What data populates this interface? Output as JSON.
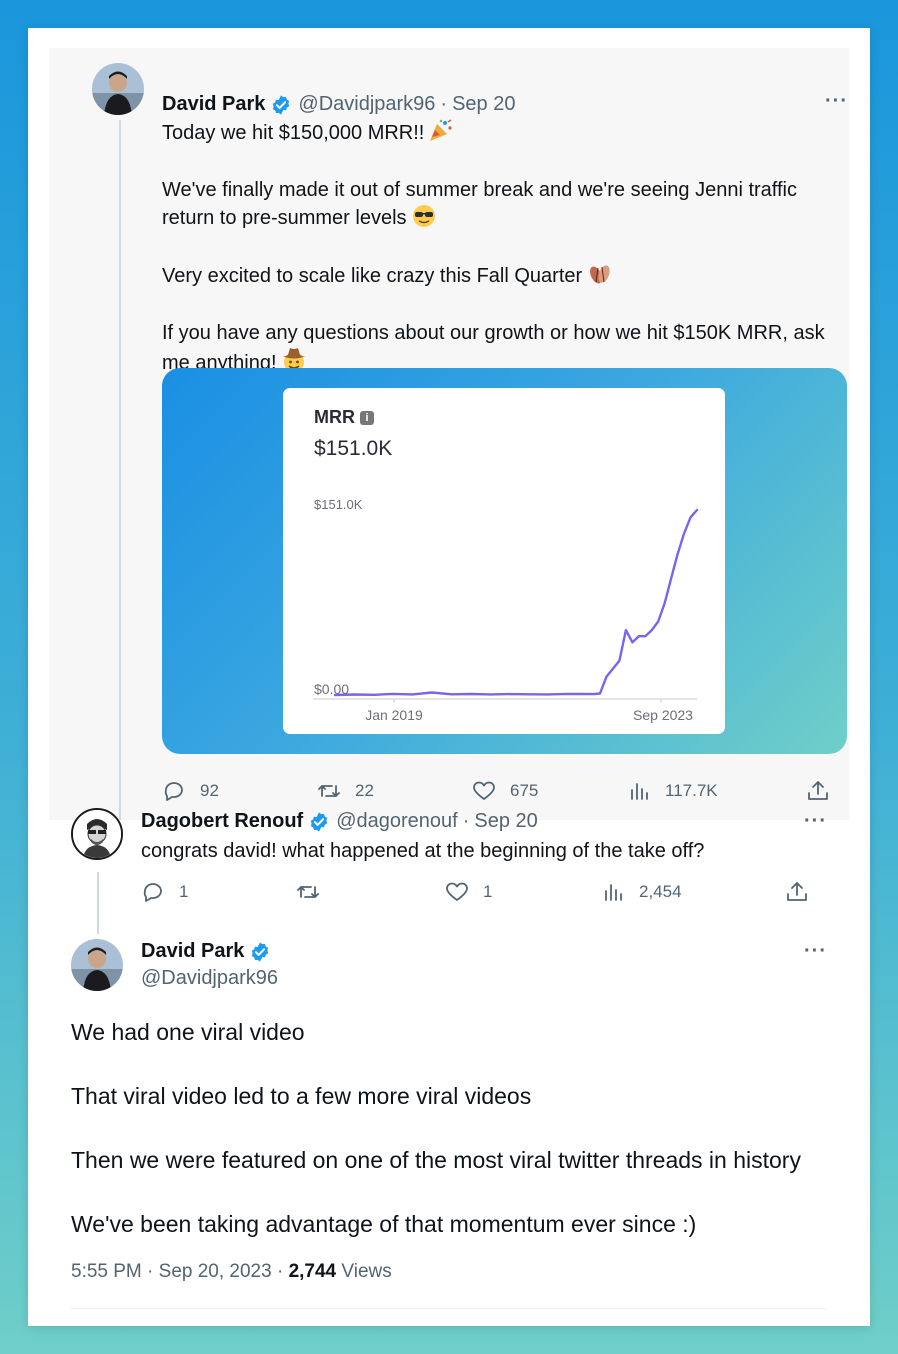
{
  "tweet1": {
    "name": "David Park",
    "handle": "@Davidjpark96",
    "date": "Sep 20",
    "lines": [
      "Today we hit $150,000 MRR!!",
      "We've finally made it out of summer break and we're seeing Jenni traffic return to pre-summer levels",
      "Very excited to scale like crazy this Fall Quarter",
      "If you have any questions about our growth or how we hit $150K MRR, ask me anything!"
    ],
    "emojis": [
      "party-popper-emoji",
      "sunglasses-face-emoji",
      "fallen-leaves-emoji",
      "cowboy-face-emoji"
    ],
    "stats": {
      "replies": "92",
      "retweets": "22",
      "likes": "675",
      "views": "117.7K"
    }
  },
  "chart_data": {
    "type": "line",
    "title": "MRR",
    "headline_value": "$151.0K",
    "y_tick_top": "$151.0K",
    "y_tick_bottom": "$0.00",
    "x_tick_start": "Jan 2019",
    "x_tick_end": "Sep 2023",
    "ylim": [
      0,
      151000
    ],
    "x": [
      "2019-01",
      "2019-04",
      "2019-07",
      "2019-10",
      "2020-01",
      "2020-04",
      "2020-07",
      "2020-10",
      "2021-01",
      "2021-04",
      "2021-07",
      "2021-10",
      "2022-01",
      "2022-03",
      "2022-05",
      "2022-06",
      "2022-07",
      "2022-09",
      "2022-10",
      "2022-11",
      "2022-12",
      "2023-01",
      "2023-02",
      "2023-03",
      "2023-04",
      "2023-05",
      "2023-06",
      "2023-07",
      "2023-08",
      "2023-09"
    ],
    "series": [
      {
        "values": [
          0,
          400,
          200,
          900,
          500,
          2000,
          600,
          800,
          500,
          700,
          600,
          500,
          900,
          800,
          700,
          1200,
          15000,
          28000,
          53000,
          43000,
          48000,
          48000,
          53000,
          60000,
          75000,
          95000,
          115000,
          132000,
          145000,
          151000
        ],
        "color": "#7b63f0"
      }
    ],
    "grid": false,
    "axis_line_color": "#c9ccd1"
  },
  "reply": {
    "name": "Dagobert Renouf",
    "handle": "@dagorenouf",
    "date": "Sep 20",
    "text": "congrats david! what happened at the beginning of the take off?",
    "stats": {
      "replies": "1",
      "likes": "1",
      "views": "2,454"
    }
  },
  "tweet3": {
    "name": "David Park",
    "handle": "@Davidjpark96",
    "paragraphs": [
      "We had one viral video",
      "That viral video led to a few more viral videos",
      "Then we were featured on one of the most viral twitter threads in history",
      "We've been taking advantage of that momentum ever since :)"
    ],
    "timestamp": "5:55 PM · Sep 20, 2023 · ",
    "views_count": "2,744",
    "views_label": " Views"
  },
  "colors": {
    "verified": "#1d9bf0",
    "muted": "#536471",
    "line": "#7b63f0"
  },
  "icons": {
    "more": "···"
  }
}
